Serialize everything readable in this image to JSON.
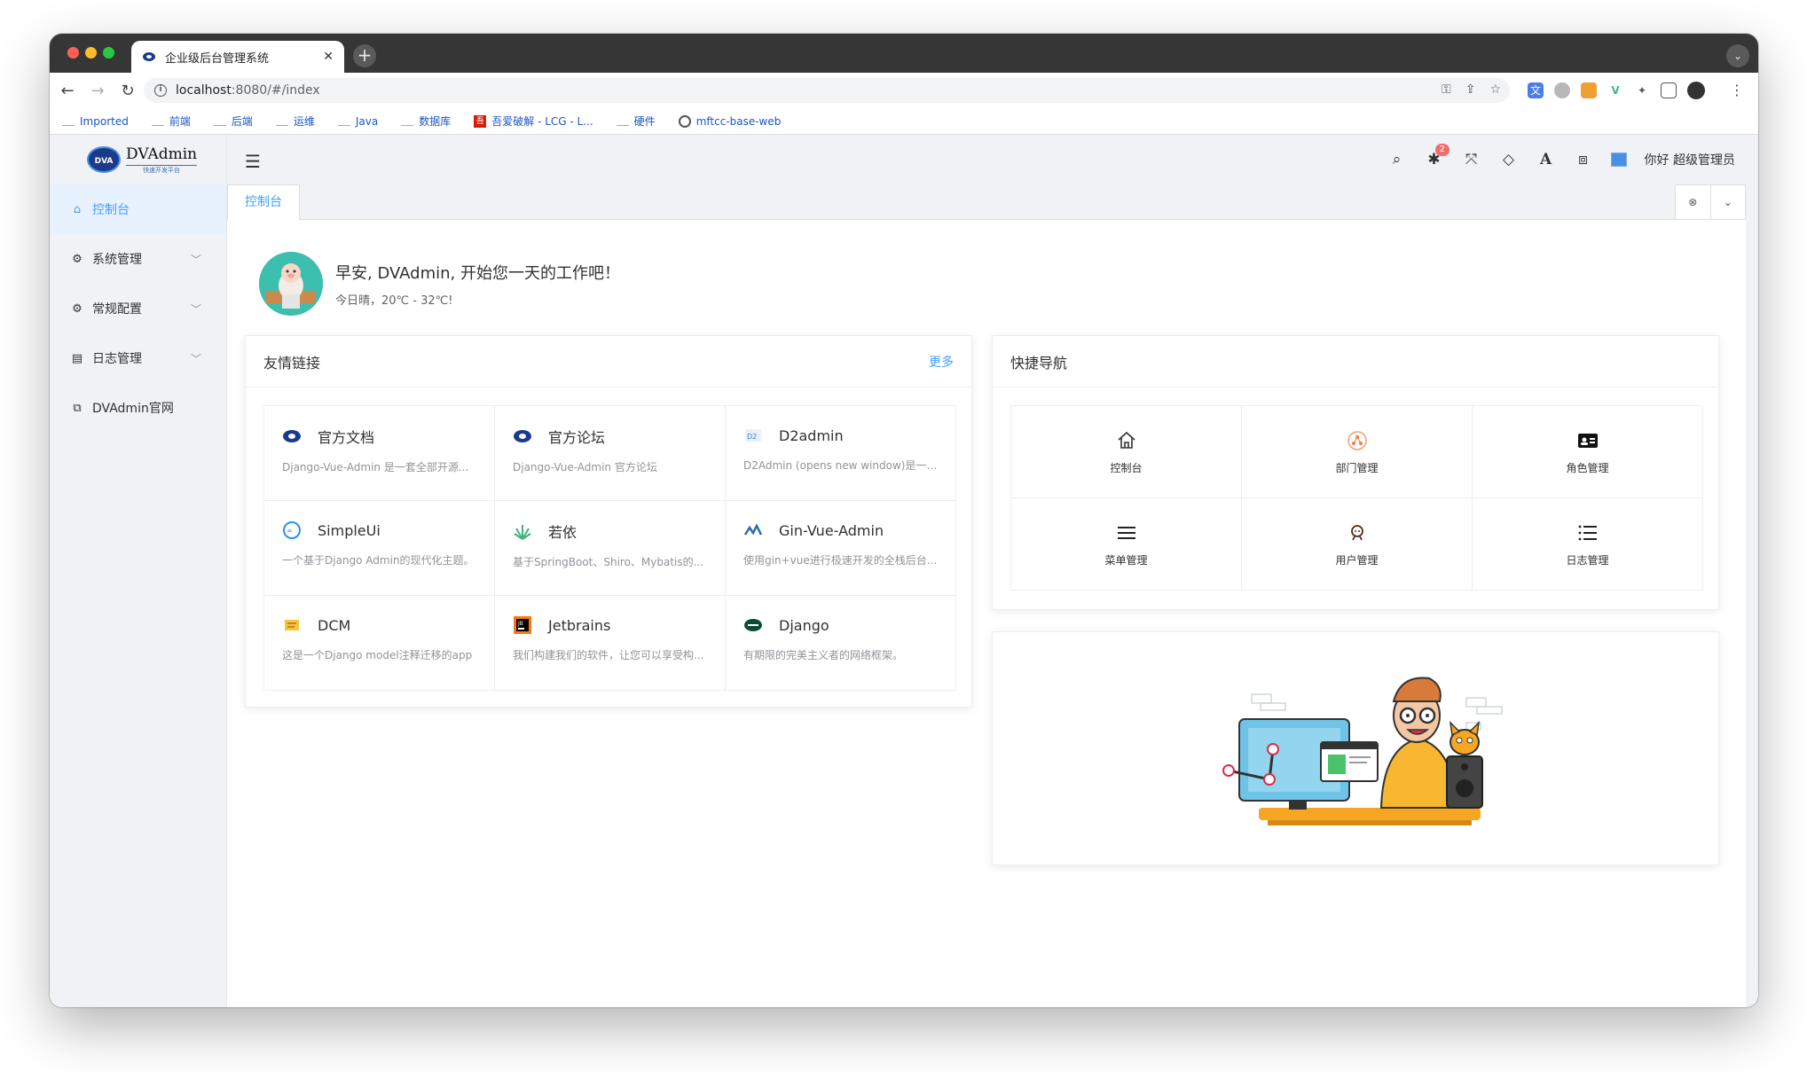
{
  "browser": {
    "tab_title": "企业级后台管理系统",
    "url_host": "localhost",
    "url_rest": ":8080/#/index",
    "bookmarks": [
      "Imported",
      "前端",
      "后端",
      "运维",
      "Java",
      "数据库",
      "吾爱破解 - LCG - L...",
      "硬件",
      "mftcc-base-web"
    ]
  },
  "app": {
    "logo_name": "DVAdmin",
    "logo_sub": "快速开发平台",
    "logo_mark": "DVA",
    "greeting_user": "你好 超级管理员",
    "notification_count": "2",
    "sidebar": [
      {
        "label": "控制台",
        "icon": "home-icon",
        "active": true
      },
      {
        "label": "系统管理",
        "icon": "gear-icon",
        "expandable": true
      },
      {
        "label": "常规配置",
        "icon": "cogs-icon",
        "expandable": true
      },
      {
        "label": "日志管理",
        "icon": "book-icon",
        "expandable": true
      },
      {
        "label": "DVAdmin官网",
        "icon": "external-link-icon"
      }
    ],
    "page_tab": "控制台"
  },
  "dashboard": {
    "welcome_title": "早安, DVAdmin, 开始您一天的工作吧！",
    "welcome_sub": "今日晴，20℃ - 32℃!",
    "links_title": "友情链接",
    "links_more": "更多",
    "links": [
      {
        "title": "官方文档",
        "desc": "Django-Vue-Admin 是一套全部开源..."
      },
      {
        "title": "官方论坛",
        "desc": "Django-Vue-Admin 官方论坛"
      },
      {
        "title": "D2admin",
        "desc": "D2Admin (opens new window)是一个..."
      },
      {
        "title": "SimpleUi",
        "desc": "一个基于Django Admin的现代化主题。"
      },
      {
        "title": "若依",
        "desc": "基于SpringBoot、Shiro、Mybatis的..."
      },
      {
        "title": "Gin-Vue-Admin",
        "desc": "使用gin+vue进行极速开发的全栈后台..."
      },
      {
        "title": "DCM",
        "desc": "这是一个Django model注释迁移的app"
      },
      {
        "title": "Jetbrains",
        "desc": "我们构建我们的软件，让您可以享受构..."
      },
      {
        "title": "Django",
        "desc": "有期限的完美主义者的网络框架。"
      }
    ],
    "nav_title": "快捷导航",
    "nav": [
      {
        "label": "控制台",
        "icon": "home-icon"
      },
      {
        "label": "部门管理",
        "icon": "department-icon"
      },
      {
        "label": "角色管理",
        "icon": "id-card-icon"
      },
      {
        "label": "菜单管理",
        "icon": "menu-icon"
      },
      {
        "label": "用户管理",
        "icon": "user-icon"
      },
      {
        "label": "日志管理",
        "icon": "list-icon"
      }
    ]
  },
  "colors": {
    "accent": "#409eff",
    "sidebar_bg": "#f0f2f5",
    "badge": "#f56c6c"
  }
}
